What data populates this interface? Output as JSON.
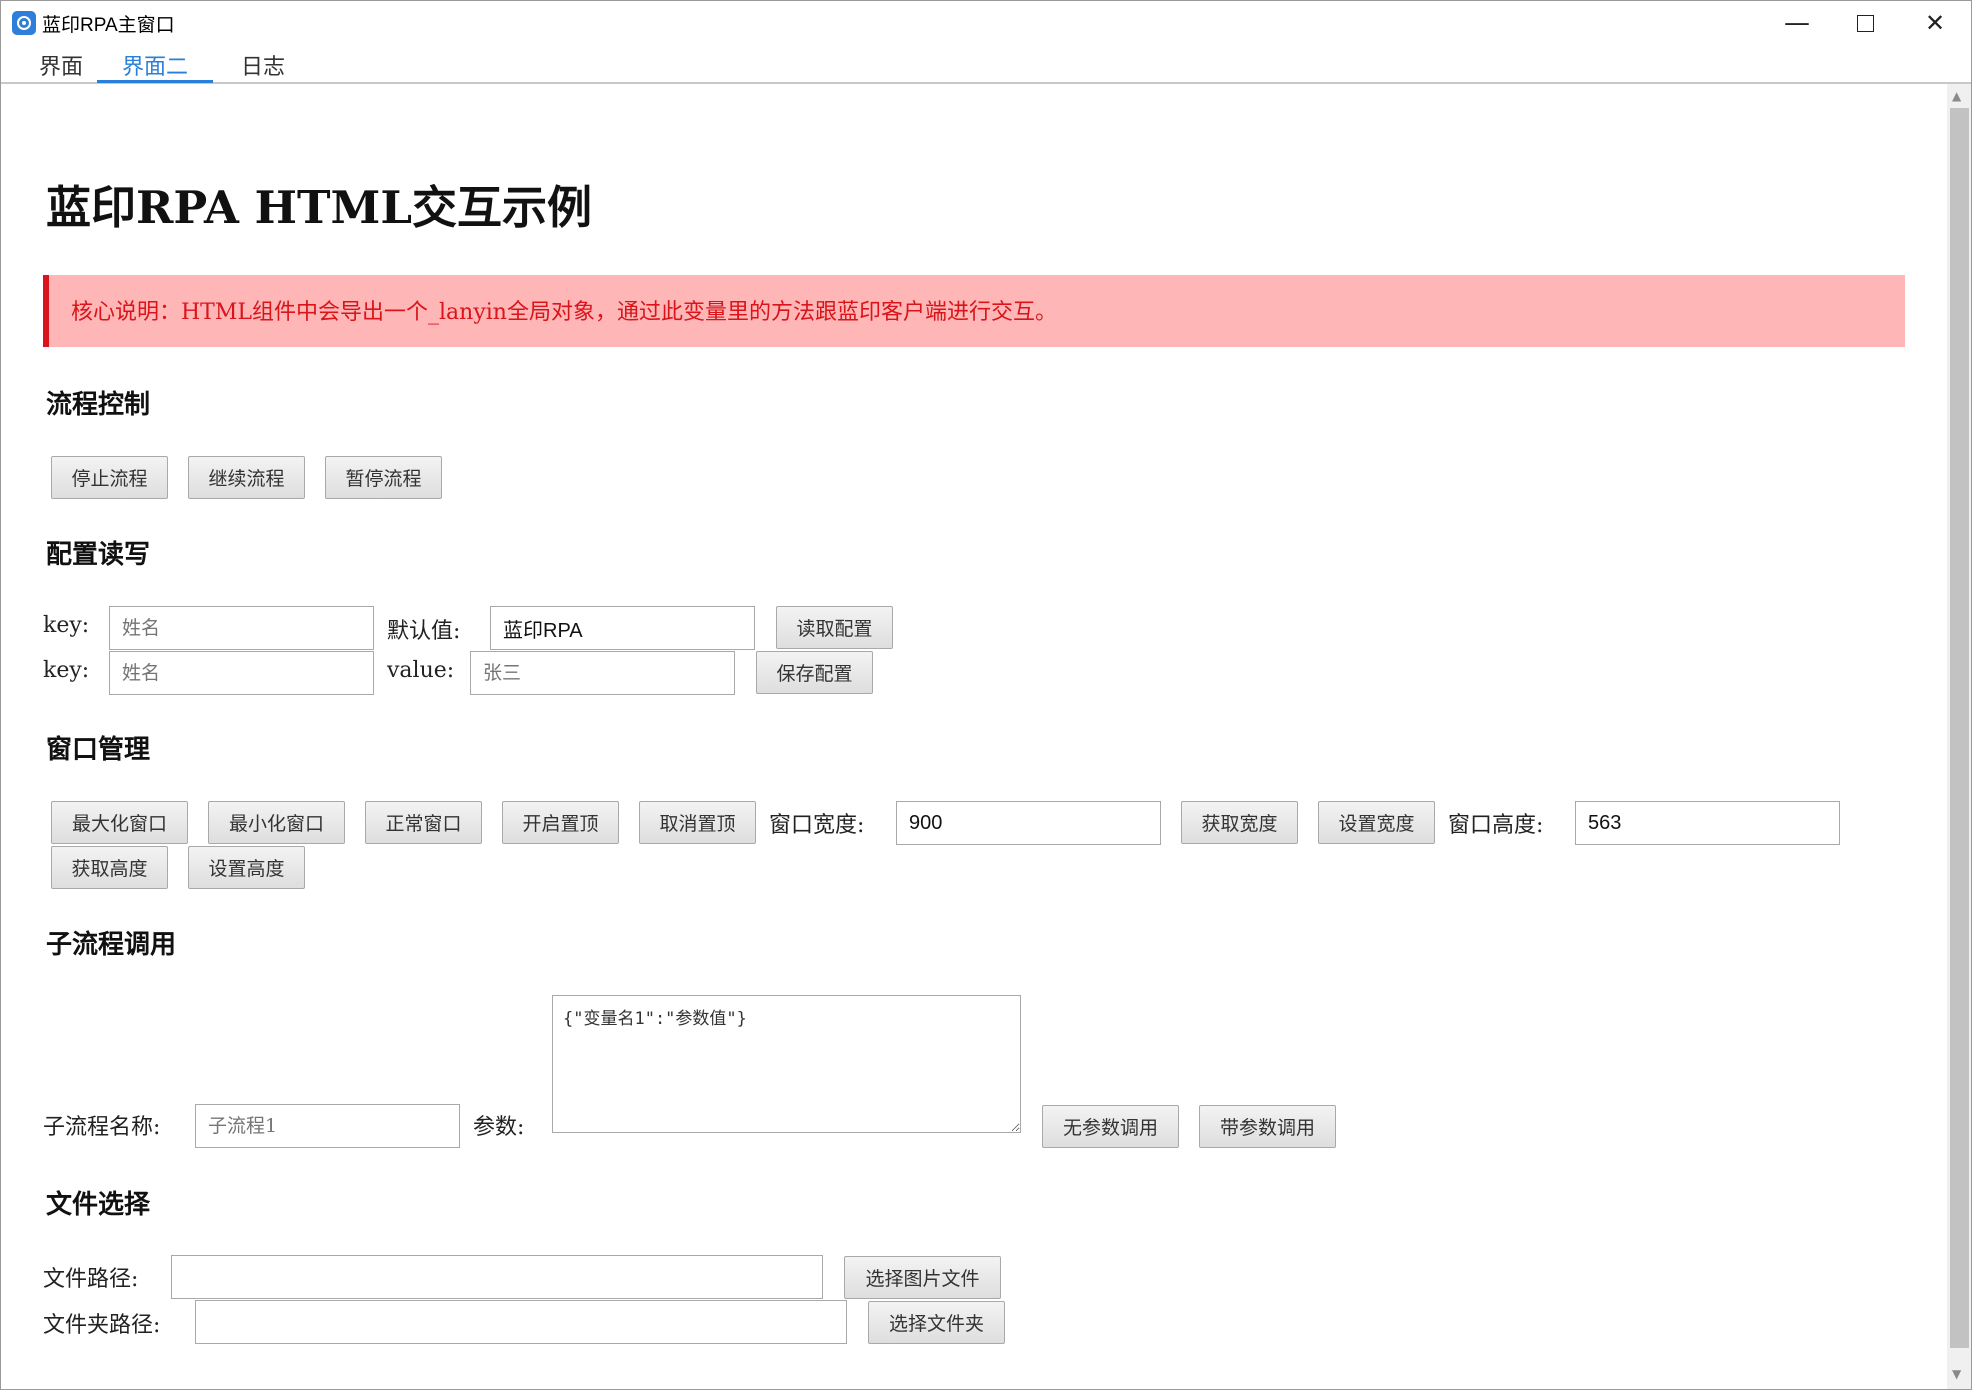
{
  "window": {
    "title": "蓝印RPA主窗口",
    "controls": {
      "minimize": "—",
      "close": "✕"
    }
  },
  "tabs": [
    {
      "label": "界面",
      "active": false
    },
    {
      "label": "界面二",
      "active": true
    },
    {
      "label": "日志",
      "active": false
    }
  ],
  "page": {
    "title": "蓝印RPA HTML交互示例",
    "notice": "核心说明：HTML组件中会导出一个_lanyin全局对象，通过此变量里的方法跟蓝印客户端进行交互。"
  },
  "flow_control": {
    "title": "流程控制",
    "buttons": {
      "stop": "停止流程",
      "continue": "继续流程",
      "pause": "暂停流程"
    }
  },
  "config": {
    "title": "配置读写",
    "read_row": {
      "key_label": "key:",
      "key_placeholder": "姓名",
      "default_label": "默认值:",
      "default_value": "蓝印RPA",
      "button": "读取配置"
    },
    "write_row": {
      "key_label": "key:",
      "key_placeholder": "姓名",
      "value_label": "value:",
      "value_placeholder": "张三",
      "button": "保存配置"
    }
  },
  "window_mgmt": {
    "title": "窗口管理",
    "buttons": {
      "maximize": "最大化窗口",
      "minimize": "最小化窗口",
      "normal": "正常窗口",
      "pin": "开启置顶",
      "unpin": "取消置顶",
      "get_width": "获取宽度",
      "set_width": "设置宽度",
      "get_height": "获取高度",
      "set_height": "设置高度"
    },
    "width_label": "窗口宽度:",
    "width_value": "900",
    "height_label": "窗口高度:",
    "height_value": "563"
  },
  "subflow": {
    "title": "子流程调用",
    "name_label": "子流程名称:",
    "name_placeholder": "子流程1",
    "params_label": "参数:",
    "params_value": "{\"变量名1\":\"参数值\"}",
    "buttons": {
      "no_params": "无参数调用",
      "with_params": "带参数调用"
    }
  },
  "file_select": {
    "title": "文件选择",
    "file_label": "文件路径:",
    "file_value": "",
    "file_button": "选择图片文件",
    "folder_label": "文件夹路径:",
    "folder_value": "",
    "folder_button": "选择文件夹"
  },
  "colors": {
    "accent": "#2a7fd9",
    "notice_bg": "#ffb6b6",
    "notice_text": "#d9141a"
  },
  "icons": [
    "app-logo-icon",
    "minimize-icon",
    "maximize-icon",
    "close-icon",
    "scroll-up-arrow-icon",
    "scroll-down-arrow-icon"
  ]
}
